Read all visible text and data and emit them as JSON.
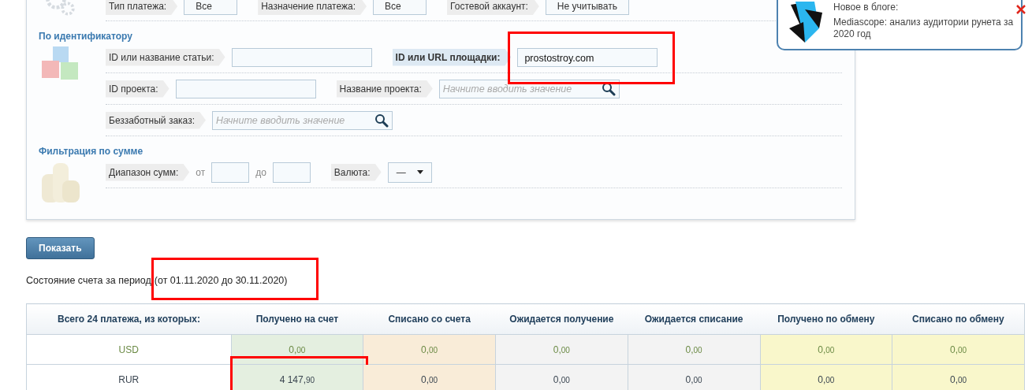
{
  "notification": {
    "title": "Новое в блоге:",
    "text": "Mediascope: анализ аудитории рунета за 2020 год"
  },
  "filters": [
    {
      "kind": "gears",
      "rows": [
        [
          {
            "kind": "select",
            "label": "Тип платежа:",
            "value": "Все"
          },
          {
            "kind": "select",
            "label": "Назначение платежа:",
            "value": "Все"
          },
          {
            "kind": "select",
            "label": "Гостевой аккаунт:",
            "value": "Не учитывать"
          }
        ]
      ]
    },
    {
      "kind": "cubes",
      "heading": "По идентификатору",
      "rows": [
        [
          {
            "kind": "text",
            "label": "ID или название статьи:"
          },
          {
            "kind": "text",
            "label": "ID или URL площадки:",
            "emphasized": true,
            "value": "prostostroy.com",
            "annotated": true
          }
        ],
        [
          {
            "kind": "text",
            "label": "ID проекта:"
          },
          {
            "kind": "search",
            "label": "Название проекта:",
            "placeholder": "Начните вводить значение"
          }
        ],
        [
          {
            "kind": "search",
            "label": "Беззаботный заказ:",
            "placeholder": "Начните вводить значение"
          }
        ]
      ]
    },
    {
      "kind": "coins",
      "heading": "Фильтрация по сумме",
      "rows": [
        [
          {
            "kind": "range",
            "label": "Диапазон сумм:",
            "from": "от",
            "to": "до"
          },
          {
            "kind": "dropdown",
            "label": "Валюта:",
            "value": "—"
          }
        ]
      ]
    }
  ],
  "show_button": "Показать",
  "period": {
    "label": "Состояние счета за период",
    "range": "(от 01.11.2020 до 30.11.2020)",
    "annotated": true
  },
  "table": {
    "columns": [
      {
        "label": "Всего 24 платежа, из которых:"
      },
      {
        "label": "Получено на счет",
        "color": "#e4efe0"
      },
      {
        "label": "Списано со счета",
        "color": "#f9ecd8"
      },
      {
        "label": "Ожидается получение",
        "color": "#f3f3f3"
      },
      {
        "label": "Ожидается списание",
        "color": "#f3f3f3"
      },
      {
        "label": "Получено по обмену",
        "color": "#f9f7cb"
      },
      {
        "label": "Списано по обмену",
        "color": "#f9f7cb"
      }
    ],
    "rows": [
      {
        "kind": "zero",
        "cells": [
          {
            "value": "USD"
          },
          {
            "value": "0,00"
          },
          {
            "value": "0,00"
          },
          {
            "value": "0,00"
          },
          {
            "value": "0,00"
          },
          {
            "value": "0,00"
          },
          {
            "value": "0,00"
          }
        ]
      },
      {
        "kind": "active",
        "cells": [
          {
            "value": "RUR"
          },
          {
            "value": "4 147,90",
            "annotated": true
          },
          {
            "value": "0,00"
          },
          {
            "value": "0,00"
          },
          {
            "value": "0,00"
          },
          {
            "value": "0,00"
          },
          {
            "value": "0,00"
          }
        ]
      }
    ]
  }
}
